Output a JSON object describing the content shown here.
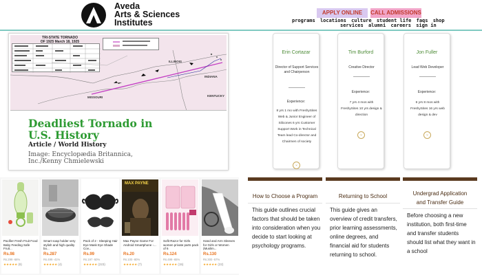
{
  "header": {
    "logo_line1": "Aveda",
    "logo_line2": "Arts & Sciences",
    "logo_line3": "Institutes",
    "apply_label": "APPLY ONLINE",
    "admissions_label": "CALL ADMISSIONS",
    "nav_row1": [
      "programs",
      "locations",
      "culture",
      "student life",
      "faqs",
      "shop"
    ],
    "nav_row2": [
      "services",
      "alumni",
      "careers",
      "sign in"
    ]
  },
  "article": {
    "map_title": "TRI-STATE TORNADO OF 1925 March 18, 1925",
    "states": [
      "MISSOURI",
      "ILLINOIS",
      "INDIANA",
      "KENTUCKY"
    ],
    "headline_line1": "Deadliest Tornado in",
    "headline_line2": "U.S. History",
    "subhead": "Article / World History",
    "credit_line1": "Image: Encyclopædia Britannica,",
    "credit_line2": "Inc./Kenny Chmielewski"
  },
  "products": [
    {
      "name": "Pacifier Fresh Fruit Food Baby Feeding Safe Fruit...",
      "price": "Rs.98",
      "orig": "Rs.299 -68%",
      "rating": "(8)"
    },
    {
      "name": "Smart soap holder very stylish and high quality bo...",
      "price": "Rs.287",
      "orig": "Rs.499 -41%",
      "rating": "(4)"
    },
    {
      "name": "Pack of 2 - Sleeping Hair Eye Mask Eye Shade Cov...",
      "price": "Rs.99",
      "orig": "Rs.197 -50%",
      "rating": "(223)"
    },
    {
      "name": "Max Payne Game For Android Smartphone -...",
      "price": "Rs.20",
      "orig": "Rs.100 -80%",
      "rating": "(7)"
    },
    {
      "name": "Sofit Razor for Girls women private parts pack of 6",
      "price": "Rs.124",
      "orig": "Rs.499 -65%",
      "rating": "(15)"
    },
    {
      "name": "Hand and Arm Sleeves for Girls or Women (Muslim...",
      "price": "Rs.130",
      "orig": "Rs.300 -57%",
      "rating": "(22)"
    }
  ],
  "product_brand_text": "MAX PAYNE",
  "staff": [
    {
      "name": "Erin Cortazar",
      "role": "Director of Support Services and Chairperson",
      "label": "Experience:",
      "desc": "8 yrs 1 mo with FreshySites Web & Junior Engineer of Silicones 6 yrs Customer Support Work in Technical Team lead Co-director and Chairmen of society"
    },
    {
      "name": "Tim Burford",
      "role": "Creative Director",
      "label": "Experience:",
      "desc": "7 yrs 4 mos with FreshySites 10 yrs design & direction"
    },
    {
      "name": "Jon Fuller",
      "role": "Lead Web Developer",
      "label": "Experience:",
      "desc": "6 yrs 8 mos with FreshySites 16 yrs web design & dev"
    }
  ],
  "guides": [
    {
      "title": "How to Choose a Program",
      "body": "This guide outlines crucial factors that should be taken into consideration when you decide to start looking at psychology programs."
    },
    {
      "title": "Returning to School",
      "body": "This guide gives an overview of credit transfers, prior learning assessments, online degrees, and financial aid for students returning to school."
    },
    {
      "title": "Undergrad Application and Transfer Guide",
      "body": "Before choosing a new institution, both first-time and transfer students should list what they want in a school"
    }
  ],
  "colors": {
    "accent_teal": "#7fc9c1",
    "headline_green": "#2e9b33",
    "guide_brown": "#5a3a1f",
    "price_orange": "#e8711b"
  }
}
